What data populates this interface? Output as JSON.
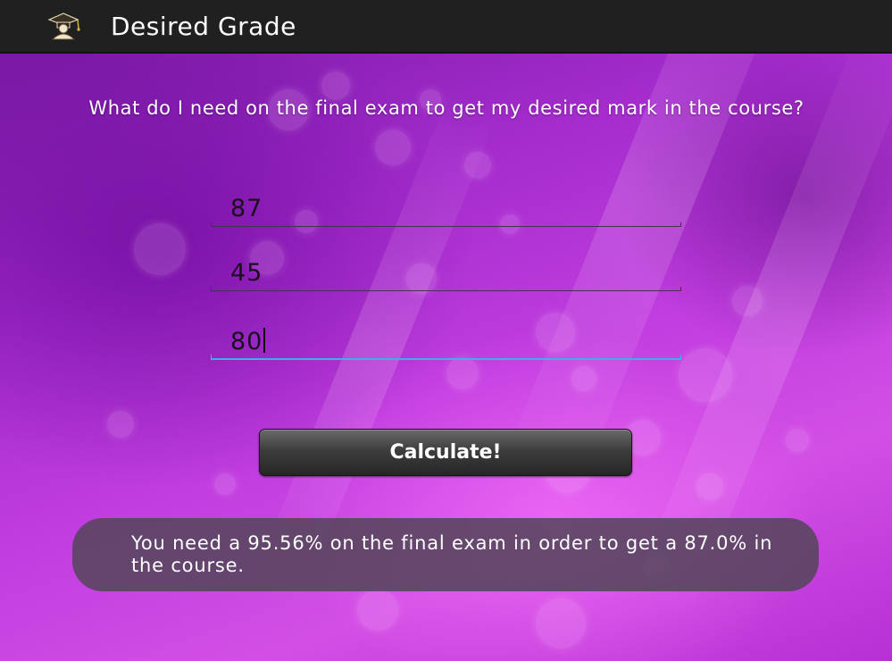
{
  "actionbar": {
    "title": "Desired Grade",
    "icon": "graduate-app-icon"
  },
  "question": {
    "text": "What do I need on the final exam to get my desired mark in the course?"
  },
  "fields": [
    {
      "value": "87",
      "focused": false
    },
    {
      "value": "45",
      "focused": false
    },
    {
      "value": "80",
      "focused": true
    }
  ],
  "calculate_button": {
    "label": "Calculate!"
  },
  "result": {
    "text": "You need a 95.56% on the final exam in order to get a 87.0% in the course."
  },
  "colors": {
    "background_accent": "#c23ee0",
    "actionbar": "#202020",
    "focus_underline": "#33b5e5"
  }
}
